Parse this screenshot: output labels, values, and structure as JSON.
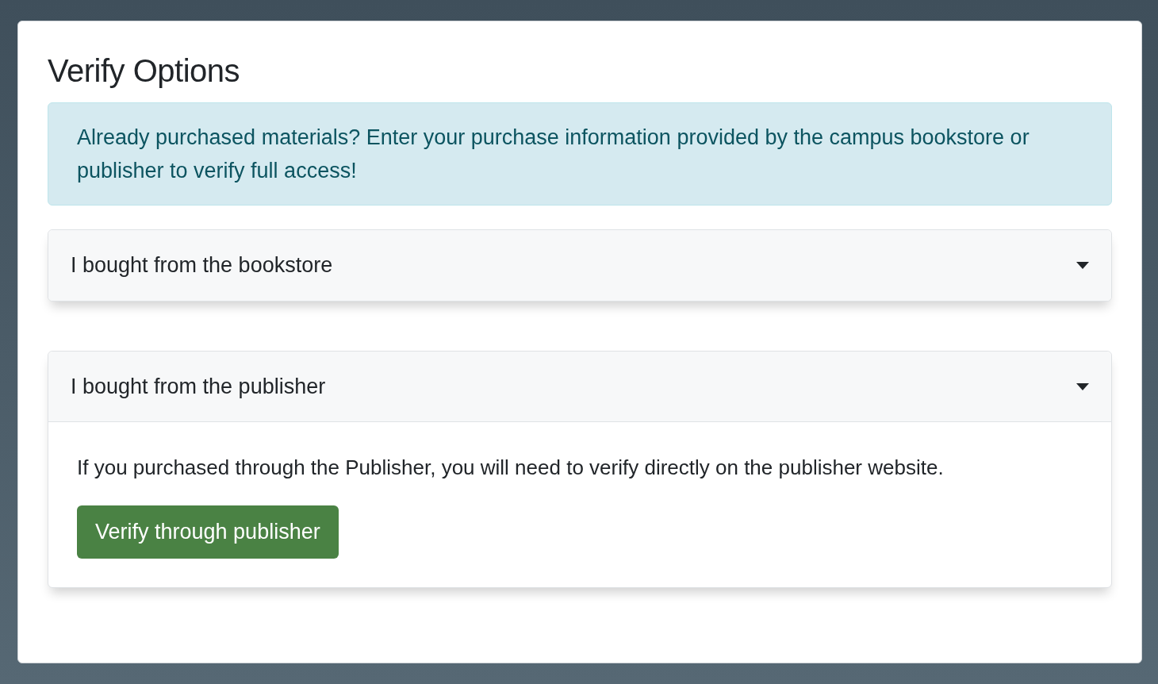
{
  "title": "Verify Options",
  "alert": "Already purchased materials? Enter your purchase information provided by the campus bookstore or publisher to verify full access!",
  "accordions": [
    {
      "label": "I bought from the bookstore",
      "expanded": false
    },
    {
      "label": "I bought from the publisher",
      "expanded": true,
      "body": "If you purchased through the Publisher, you will need to verify directly on the publisher website.",
      "button": "Verify through publisher"
    }
  ]
}
